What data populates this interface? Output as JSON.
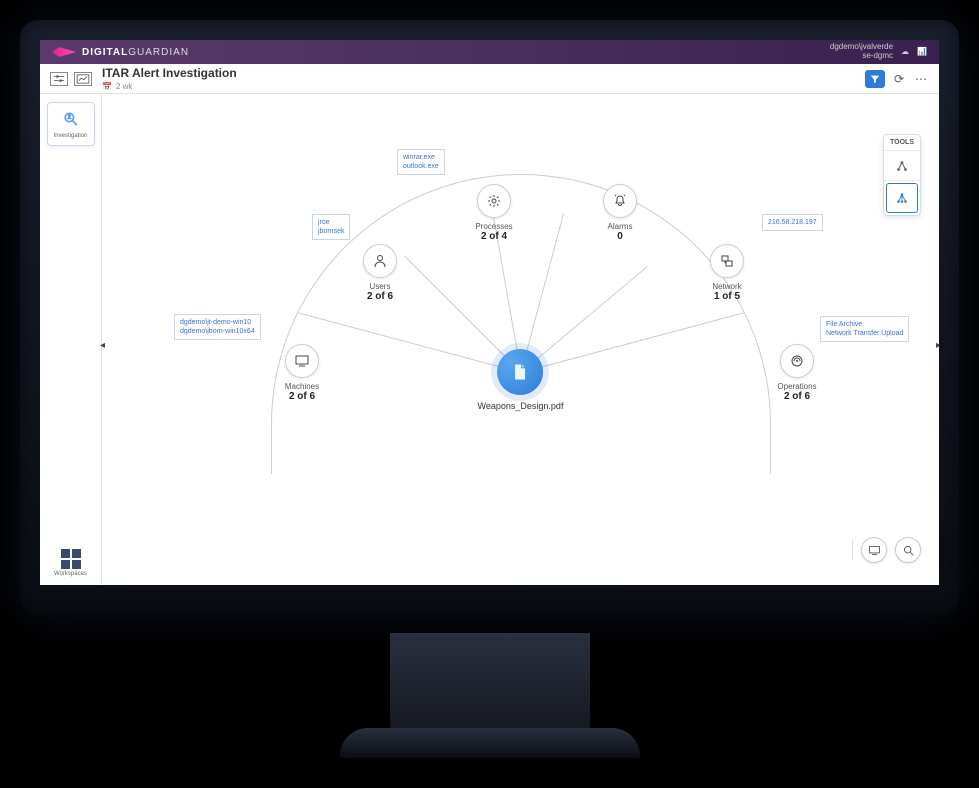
{
  "brand": {
    "name1": "DIGITAL",
    "name2": "GUARDIAN"
  },
  "user": {
    "line1": "dgdemo\\jvalverde",
    "line2": "se-dgmc"
  },
  "header": {
    "title": "ITAR Alert Investigation",
    "range": "2 wk"
  },
  "rail": {
    "item_label": "Investigation",
    "workspaces": "Workspaces"
  },
  "tools": {
    "title": "TOOLS"
  },
  "center": {
    "label": "Weapons_Design.pdf"
  },
  "nodes": {
    "machines": {
      "label": "Machines",
      "count": "2 of 6"
    },
    "users": {
      "label": "Users",
      "count": "2 of 6"
    },
    "processes": {
      "label": "Processes",
      "count": "2 of 4"
    },
    "alarms": {
      "label": "Alarms",
      "count": "0"
    },
    "network": {
      "label": "Network",
      "count": "1 of 5"
    },
    "operations": {
      "label": "Operations",
      "count": "2 of 6"
    }
  },
  "callouts": {
    "machines": "dgdemo\\jt-demo-win10\ndgdemo\\jborn-win10x64",
    "users": "jroe\njbornsek",
    "processes": "winrar.exe\noutlook.exe",
    "network": "216.58.218.197",
    "operations": "File Archive\nNetwork Transfer Upload"
  }
}
